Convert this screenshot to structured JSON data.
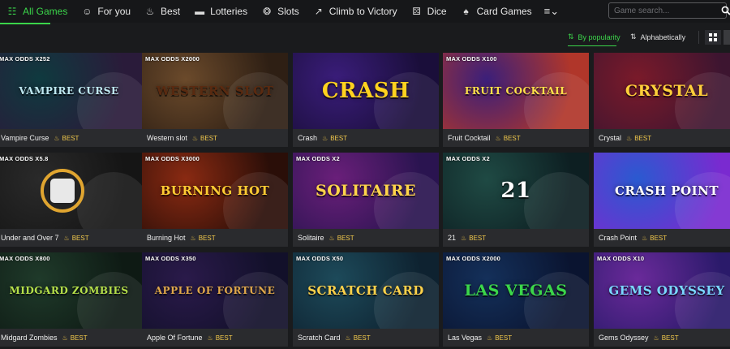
{
  "nav": {
    "items": [
      {
        "label": "All Games",
        "icon": "gamepad-icon",
        "glyph": "☷"
      },
      {
        "label": "For you",
        "icon": "user-icon",
        "glyph": "☺"
      },
      {
        "label": "Best",
        "icon": "fire-icon",
        "glyph": "♨"
      },
      {
        "label": "Lotteries",
        "icon": "ticket-icon",
        "glyph": "▬"
      },
      {
        "label": "Slots",
        "icon": "slot-icon",
        "glyph": "❂"
      },
      {
        "label": "Climb to Victory",
        "icon": "stairs-icon",
        "glyph": "↗"
      },
      {
        "label": "Dice",
        "icon": "dice-icon",
        "glyph": "⚄"
      },
      {
        "label": "Card Games",
        "icon": "spade-icon",
        "glyph": "♠"
      }
    ],
    "more_glyph": "≡⌄"
  },
  "search": {
    "placeholder": "Game search..."
  },
  "sort": {
    "popularity": "By popularity",
    "alphabetical": "Alphabetically"
  },
  "best_label": "BEST",
  "games": [
    {
      "name": "Vampire Curse",
      "odds": "MAX ODDS X252",
      "logo": "VAMPIRE CURSE",
      "bg": [
        "#0f3a3f",
        "#2a1b3a"
      ],
      "logoColor": "#bfe8f0"
    },
    {
      "name": "Western slot",
      "odds": "MAX ODDS X2000",
      "logo": "WESTERN SLOT",
      "bg": [
        "#6b4a2b",
        "#2e1f14"
      ],
      "logoColor": "#5a2a10"
    },
    {
      "name": "Crash",
      "odds": "",
      "logo": "CRASH",
      "bg": [
        "#3a1d7a",
        "#1a0e3a"
      ],
      "logoColor": "#ffd21f"
    },
    {
      "name": "Fruit Cocktail",
      "odds": "MAX ODDS X100",
      "logo": "FRUIT COCKTAIL",
      "bg": [
        "#3b1f7a",
        "#b0362a"
      ],
      "logoColor": "#ffe14a"
    },
    {
      "name": "Crystal",
      "odds": "",
      "logo": "CRYSTAL",
      "bg": [
        "#7a1a2a",
        "#3d1530"
      ],
      "logoColor": "#ffcf3a"
    },
    {
      "name": "Under and Over 7",
      "odds": "MAX ODDS X5.8",
      "logo": "",
      "bg": [
        "#2a2a2a",
        "#151515"
      ],
      "logoColor": "#ffffff"
    },
    {
      "name": "Burning Hot",
      "odds": "MAX ODDS X3000",
      "logo": "BURNING HOT",
      "bg": [
        "#8a2a12",
        "#2a0e08"
      ],
      "logoColor": "#ffcc33"
    },
    {
      "name": "Solitaire",
      "odds": "MAX ODDS X2",
      "logo": "SOLITAIRE",
      "bg": [
        "#6a1f7a",
        "#2a1450"
      ],
      "logoColor": "#ffd54a"
    },
    {
      "name": "21",
      "odds": "MAX ODDS X2",
      "logo": "21",
      "bg": [
        "#1f4a44",
        "#0d1f22"
      ],
      "logoColor": "#ffffff"
    },
    {
      "name": "Crash Point",
      "odds": "",
      "logo": "CRASH POINT",
      "bg": [
        "#2a5ad0",
        "#7a2ad0"
      ],
      "logoColor": "#ffffff"
    },
    {
      "name": "Midgard Zombies",
      "odds": "MAX ODDS X800",
      "logo": "MIDGARD ZOMBIES",
      "bg": [
        "#1f3a2a",
        "#0e1a14"
      ],
      "logoColor": "#b6e04a"
    },
    {
      "name": "Apple Of Fortune",
      "odds": "MAX ODDS X350",
      "logo": "APPLE OF FORTUNE",
      "bg": [
        "#2a1a4a",
        "#12102a"
      ],
      "logoColor": "#e0a84a"
    },
    {
      "name": "Scratch Card",
      "odds": "MAX ODDS X50",
      "logo": "SCRATCH CARD",
      "bg": [
        "#1d4a5a",
        "#0e2230"
      ],
      "logoColor": "#ffd24a"
    },
    {
      "name": "Las Vegas",
      "odds": "MAX ODDS X2000",
      "logo": "LAS VEGAS",
      "bg": [
        "#14305a",
        "#0a1430"
      ],
      "logoColor": "#3bd64a"
    },
    {
      "name": "Gems Odyssey",
      "odds": "MAX ODDS X10",
      "logo": "GEMS ODYSSEY",
      "bg": [
        "#6a2a9a",
        "#2a1a6a"
      ],
      "logoColor": "#7ad8ff"
    }
  ]
}
